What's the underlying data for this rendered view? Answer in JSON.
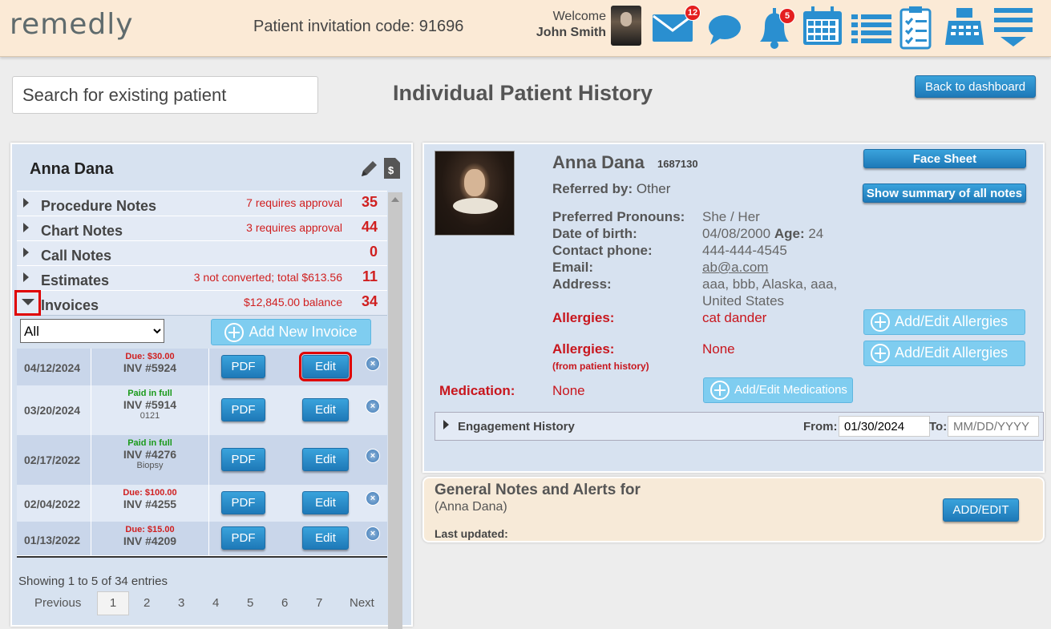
{
  "header": {
    "logo": "remedly",
    "invitation": "Patient invitation code: 91696",
    "welcome": "Welcome",
    "user": "John Smith",
    "mail_badge": "12",
    "bell_badge": "5",
    "icons": [
      "mail-icon",
      "chat-icon",
      "bell-icon",
      "calendar-icon",
      "list-icon",
      "checklist-icon",
      "register-icon",
      "menu-icon"
    ]
  },
  "search": {
    "placeholder": "Search for existing patient"
  },
  "page": {
    "title": "Individual Patient History",
    "back_label": "Back to dashboard"
  },
  "left": {
    "patient_name": "Anna Dana",
    "sections": [
      {
        "label": "Procedure Notes",
        "note": "7 requires approval",
        "count": "35"
      },
      {
        "label": "Chart Notes",
        "note": "3 requires approval",
        "count": "44"
      },
      {
        "label": "Call Notes",
        "note": "",
        "count": "0"
      },
      {
        "label": "Estimates",
        "note": "3 not converted; total $613.56",
        "count": "11"
      },
      {
        "label": "Invoices",
        "note": "$12,845.00 balance",
        "count": "34"
      }
    ],
    "filter_value": "All",
    "new_invoice": "Add New Invoice",
    "invoices": [
      {
        "date": "04/12/2024",
        "status": "Due: $30.00",
        "status_type": "due",
        "inv": "INV #5924",
        "sub": ""
      },
      {
        "date": "03/20/2024",
        "status": "Paid in full",
        "status_type": "paid",
        "inv": "INV #5914",
        "sub": "0121"
      },
      {
        "date": "02/17/2022",
        "status": "Paid in full",
        "status_type": "paid",
        "inv": "INV #4276",
        "sub": "Biopsy"
      },
      {
        "date": "02/04/2022",
        "status": "Due: $100.00",
        "status_type": "due",
        "inv": "INV #4255",
        "sub": ""
      },
      {
        "date": "01/13/2022",
        "status": "Due: $15.00",
        "status_type": "due",
        "inv": "INV #4209",
        "sub": ""
      }
    ],
    "pdf_label": "PDF",
    "edit_label": "Edit",
    "showing": "Showing 1 to 5 of 34 entries",
    "pager": {
      "prev": "Previous",
      "pages": [
        "1",
        "2",
        "3",
        "4",
        "5",
        "6",
        "7"
      ],
      "next": "Next"
    }
  },
  "right": {
    "name": "Anna Dana",
    "id": "1687130",
    "referred_label": "Referred by:",
    "referred": "Other",
    "pronouns_label": "Preferred Pronouns:",
    "pronouns": "She / Her",
    "dob_label": "Date of birth:",
    "dob": "04/08/2000",
    "age_label": "Age:",
    "age": "24",
    "phone_label": "Contact phone:",
    "phone": "444-444-4545",
    "email_label": "Email:",
    "email": "ab@a.com",
    "address_label": "Address:",
    "address_1": "aaa, bbb, Alaska, aaa,",
    "address_2": "United States",
    "allergies_label": "Allergies:",
    "allergies": "cat dander",
    "allergies2_label": "Allergies:",
    "allergies2_sub": "(from patient history)",
    "allergies2": "None",
    "medication_label": "Medication:",
    "medication": "None",
    "face_sheet": "Face Sheet",
    "summary": "Show summary of all notes",
    "add_allergies": "Add/Edit Allergies",
    "add_meds": "Add/Edit Medications",
    "engagement": "Engagement History",
    "from_label": "From:",
    "from_value": "01/30/2024",
    "to_label": "To:",
    "to_placeholder": "MM/DD/YYYY"
  },
  "notes": {
    "title": "General Notes and Alerts for",
    "sub": "(Anna Dana)",
    "updated": "Last updated:",
    "button": "ADD/EDIT"
  }
}
